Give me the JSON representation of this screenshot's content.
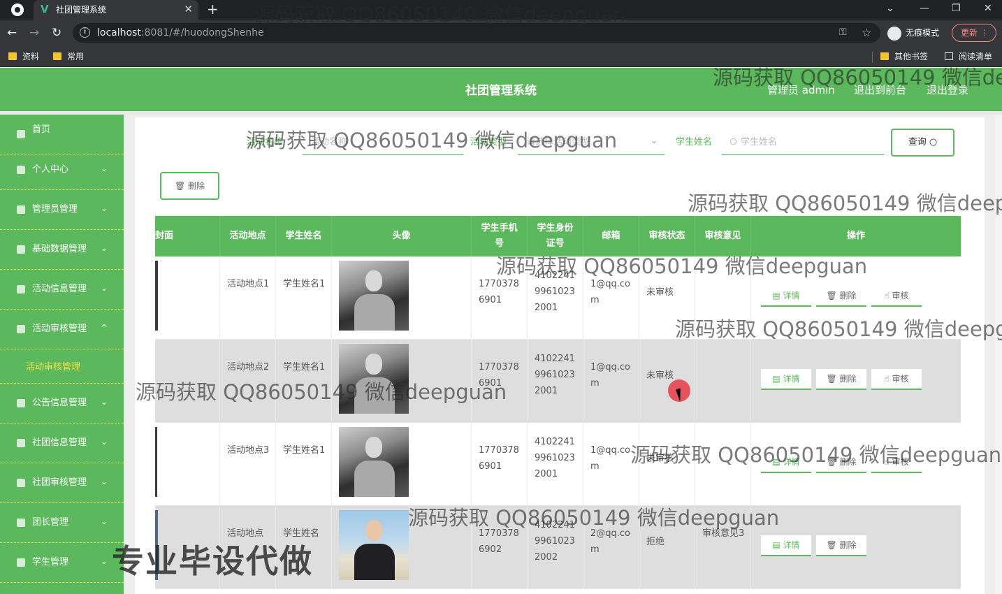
{
  "browser": {
    "tab_title": "社团管理系统",
    "url_host": "localhost",
    "url_rest": ":8081/#/huodongShenhe",
    "incognito_label": "无痕模式",
    "update_label": "更新",
    "bookmarks": [
      "资料",
      "常用",
      "其他书签",
      "阅读清单"
    ]
  },
  "header": {
    "title": "社团管理系统",
    "user": "管理员 admin",
    "to_front": "退出到前台",
    "logout": "退出登录"
  },
  "sidebar": {
    "items": [
      {
        "label": "首页",
        "chevron": ""
      },
      {
        "label": "个人中心",
        "chevron": "⌄"
      },
      {
        "label": "管理员管理",
        "chevron": "⌄"
      },
      {
        "label": "基础数据管理",
        "chevron": "⌄"
      },
      {
        "label": "活动信息管理",
        "chevron": "⌄"
      },
      {
        "label": "活动审核管理",
        "chevron": "^"
      },
      {
        "label": "公告信息管理",
        "chevron": "⌄"
      },
      {
        "label": "社团信息管理",
        "chevron": "⌄"
      },
      {
        "label": "社团审核管理",
        "chevron": "⌄"
      },
      {
        "label": "团长管理",
        "chevron": "⌄"
      },
      {
        "label": "学生管理",
        "chevron": "⌄"
      }
    ],
    "submenu_label": "活动审核管理"
  },
  "search": {
    "field1_label": "活动名称",
    "field1_placeholder": "活动名称",
    "field2_label": "活动类型",
    "field2_placeholder": "请选择活动类型",
    "field3_label": "学生姓名",
    "field3_placeholder": "学生姓名",
    "query_button": "查询"
  },
  "actions": {
    "delete_button": "删除"
  },
  "table": {
    "headers": [
      "封面",
      "活动地点",
      "学生姓名",
      "头像",
      "学生手机号",
      "学生身份证号",
      "邮箱",
      "审核状态",
      "审核意见",
      "操作"
    ],
    "rows": [
      {
        "place": "活动地点1",
        "student": "学生姓名1",
        "phone": "17703786901",
        "idcard": "410224199610232001",
        "email": "1@qq.com",
        "status": "未审核",
        "opinion": "",
        "buttons": [
          "详情",
          "删除",
          "审核"
        ]
      },
      {
        "place": "活动地点2",
        "student": "学生姓名1",
        "phone": "17703786901",
        "idcard": "410224199610232001",
        "email": "1@qq.com",
        "status": "未审核",
        "opinion": "",
        "buttons": [
          "详情",
          "删除",
          "审核"
        ]
      },
      {
        "place": "活动地点3",
        "student": "学生姓名1",
        "phone": "17703786901",
        "idcard": "410224199610232001",
        "email": "1@qq.com",
        "status": "未审核",
        "opinion": "",
        "buttons": [
          "详情",
          "删除",
          "审核"
        ]
      },
      {
        "place": "活动地点",
        "student": "学生姓名",
        "phone": "17703786902",
        "idcard": "410224199610232002",
        "email": "2@qq.com",
        "status": "拒绝",
        "opinion": "审核意见3",
        "buttons": [
          "详情",
          "删除"
        ]
      }
    ]
  },
  "watermarks": {
    "text": "源码获取 QQ86050149 微信deepguan",
    "banner": "专业毕设代做"
  },
  "colors": {
    "primary": "#5cb85c",
    "accent_yellow": "#f1e24a"
  }
}
